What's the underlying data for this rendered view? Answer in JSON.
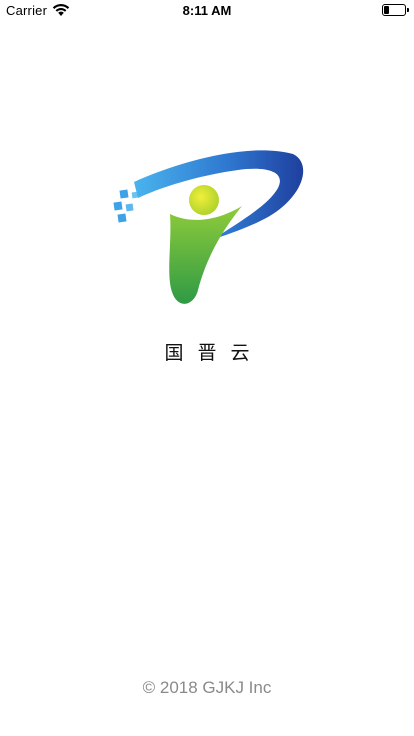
{
  "status_bar": {
    "carrier": "Carrier",
    "time": "8:11 AM",
    "battery_level_percent": 25
  },
  "splash": {
    "app_name": "国晋云",
    "copyright": "© 2018 GJKJ Inc"
  },
  "colors": {
    "logo_blue_dark": "#1f3f9e",
    "logo_blue_light": "#3fa2e6",
    "logo_green": "#3da84a",
    "logo_yellow_green": "#d7e21e",
    "text_dark": "#111111",
    "copyright_gray": "#8a8a8a"
  }
}
